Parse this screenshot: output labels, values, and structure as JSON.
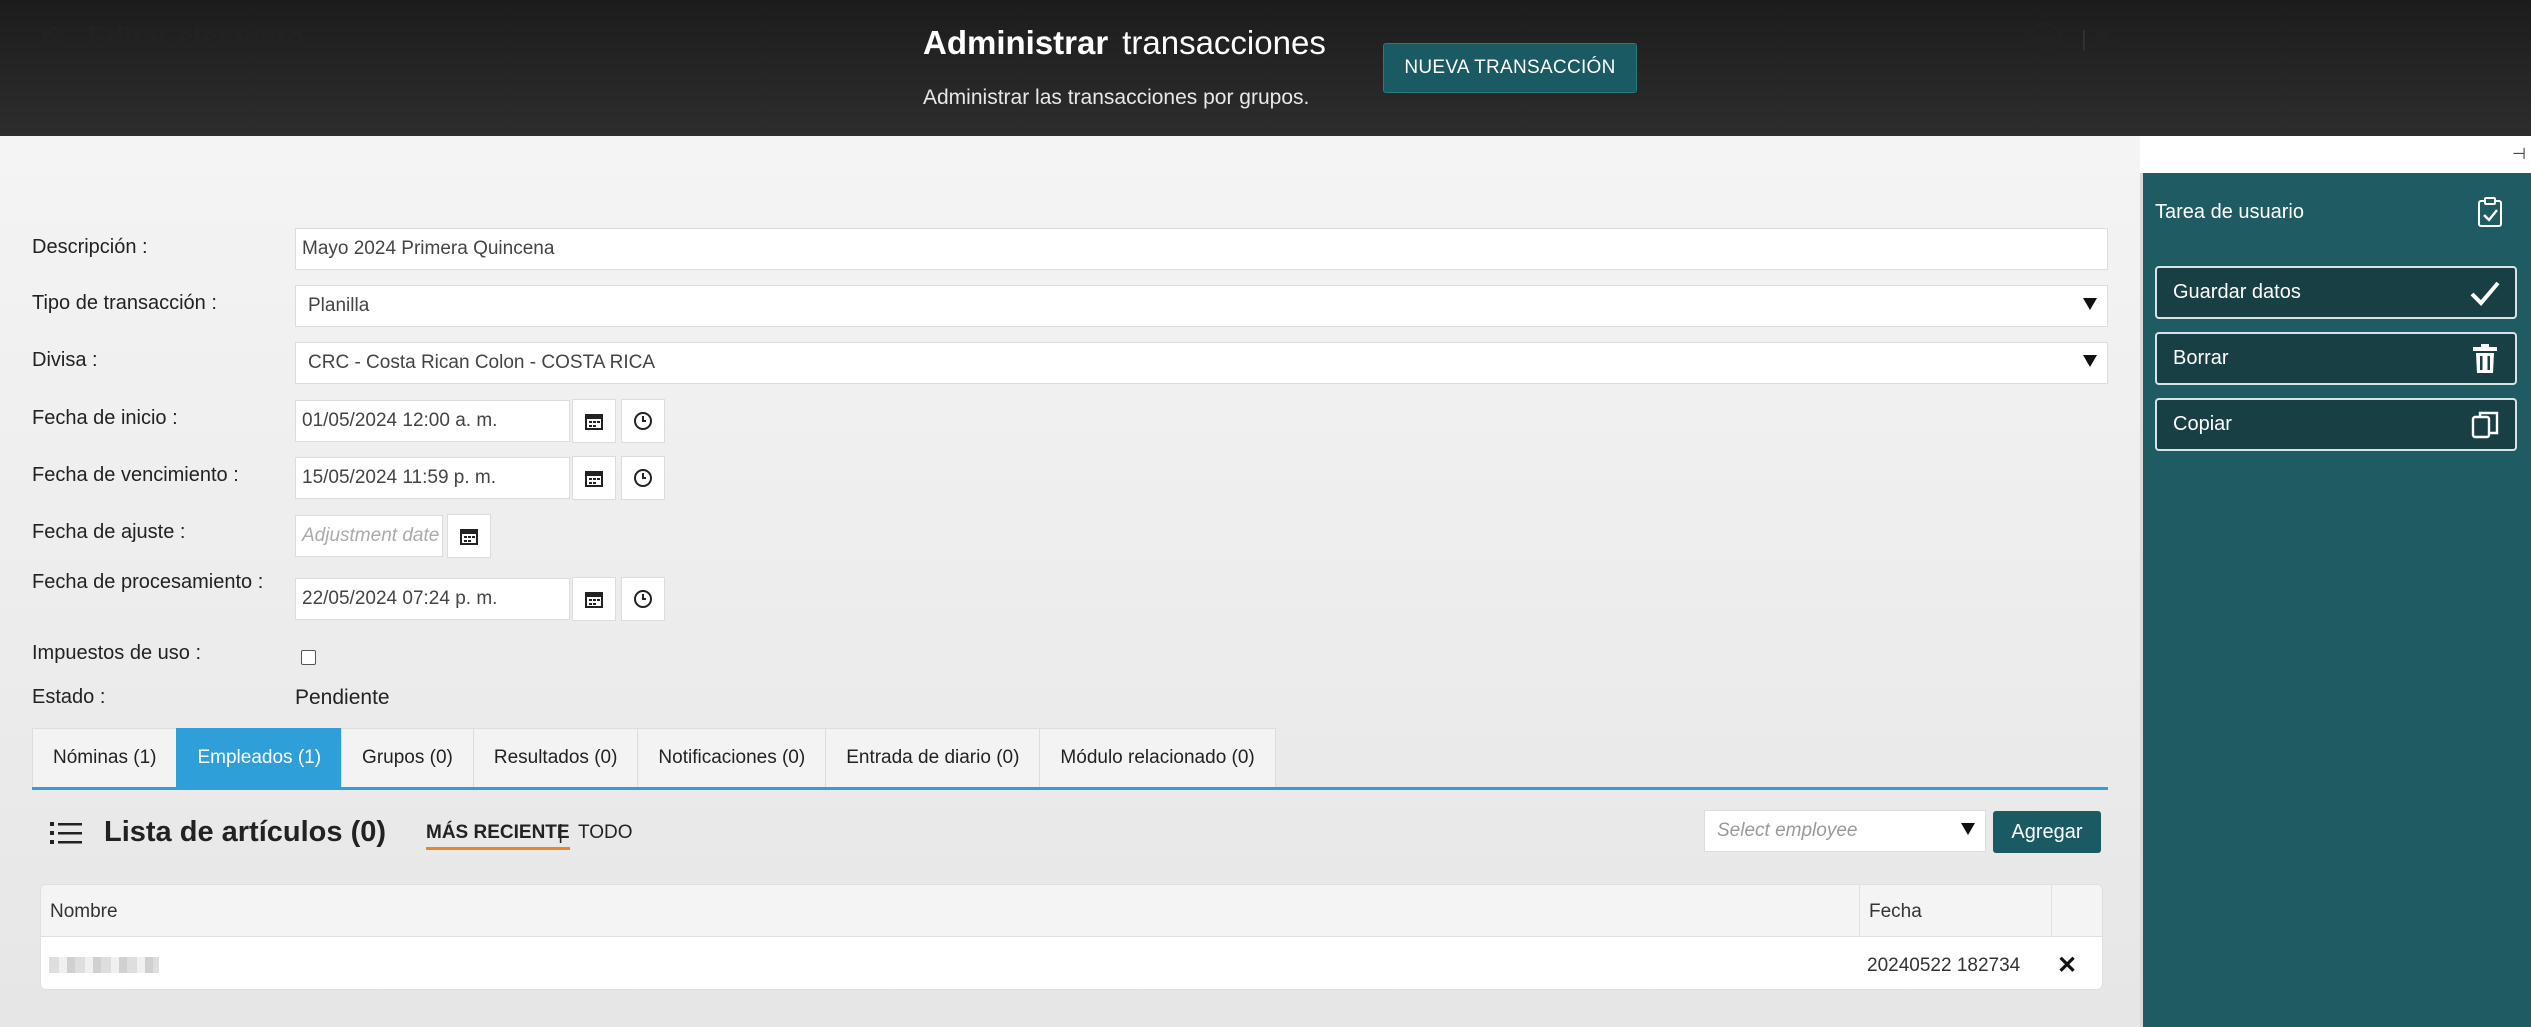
{
  "header": {
    "title_bold": "Administrar",
    "title_rest": "transacciones",
    "subtitle": "Administrar las transacciones por grupos.",
    "new_button": "NUEVA TRANSACCIÓN"
  },
  "form": {
    "title": "Editar elemento",
    "separator": "|",
    "fields": {
      "description_label": "Descripción",
      "description_value": "Mayo 2024 Primera Quincena",
      "type_label": "Tipo de transacción",
      "type_value": "Planilla",
      "currency_label": "Divisa",
      "currency_value": "CRC - Costa Rican Colon - COSTA RICA",
      "start_label": "Fecha de inicio",
      "start_value": "01/05/2024 12:00 a. m.",
      "due_label": "Fecha de vencimiento",
      "due_value": "15/05/2024 11:59 p. m.",
      "adjust_label": "Fecha de ajuste",
      "adjust_placeholder": "Adjustment date",
      "process_label": "Fecha de procesamiento",
      "process_value": "22/05/2024 07:24 p. m.",
      "tax_label": "Impuestos de uso",
      "status_label": "Estado",
      "status_value": "Pendiente"
    },
    "label_suffix": ":"
  },
  "tabs": [
    {
      "label": "Nóminas (1)"
    },
    {
      "label": "Empleados (1)"
    },
    {
      "label": "Grupos (0)"
    },
    {
      "label": "Resultados (0)"
    },
    {
      "label": "Notificaciones (0)"
    },
    {
      "label": "Entrada de diario (0)"
    },
    {
      "label": "Módulo relacionado (0)"
    }
  ],
  "list": {
    "title": "Lista de artículos (0)",
    "filter_recent": "MÁS RECIENTE",
    "filter_sep": "|",
    "filter_all": "TODO",
    "select_placeholder": "Select employee",
    "add_button": "Agregar",
    "columns": {
      "name": "Nombre",
      "date": "Fecha"
    },
    "rows": [
      {
        "date": "20240522 182734",
        "delete": "✕"
      }
    ]
  },
  "sidebar": {
    "title": "Tarea de usuario",
    "buttons": [
      {
        "label": "Guardar datos"
      },
      {
        "label": "Borrar"
      },
      {
        "label": "Copiar"
      }
    ]
  },
  "colors": {
    "accent": "#2f9fd9",
    "teal": "#1f5b63",
    "button": "#1a5a62",
    "underline": "#e8872a"
  },
  "icons": [
    "edit-icon",
    "back-arrow-icon",
    "flag-icon",
    "calendar-icon",
    "clock-icon",
    "list-icon",
    "clipboard-check-icon",
    "checkmark-icon",
    "trash-icon",
    "copy-icon",
    "pin-icon",
    "close-icon"
  ]
}
